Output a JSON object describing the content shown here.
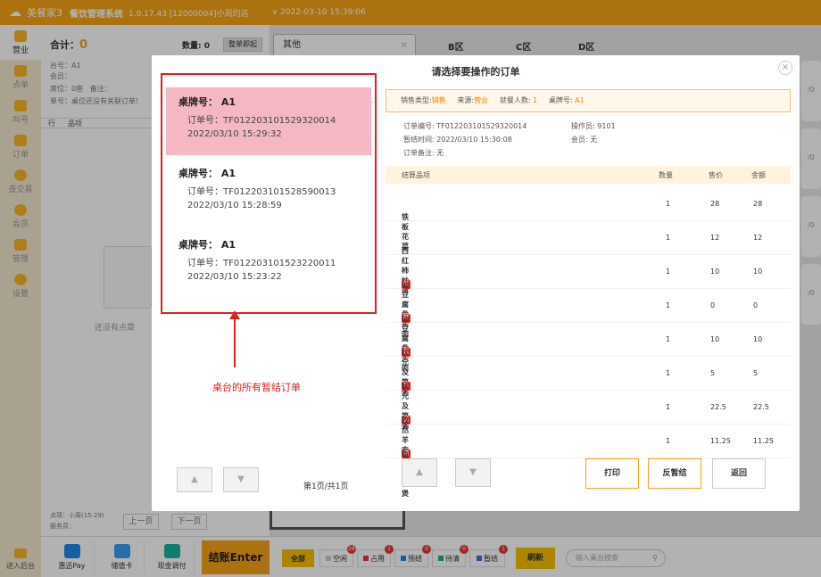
{
  "titlebar": {
    "brand": "美餐家3",
    "system": "餐饮管理系统",
    "version": "1.0.17.43 [12000004]小周的店",
    "datetime": "2022-03-10 15:39:06"
  },
  "nav": {
    "items": [
      {
        "label": "营业"
      },
      {
        "label": "点单"
      },
      {
        "label": "叫号"
      },
      {
        "label": "订单"
      },
      {
        "label": "查交易"
      },
      {
        "label": "会员"
      },
      {
        "label": "管理"
      },
      {
        "label": "设置"
      }
    ],
    "bottom": "进入后台"
  },
  "order": {
    "total_label": "合计：",
    "total_value": "0",
    "qty_label": "数量: 0",
    "qty_btn": "整单即起",
    "table": "台号：A1",
    "member": "会员：",
    "seats": "席位：0座",
    "remark": "备注：",
    "bill": "单号：桌位还没有关联订单!",
    "col_row": "行",
    "col_item": "品项",
    "empty": "还没有点菜",
    "footer_1": "点项：小周(15:29)",
    "footer_2": "服务员：",
    "prev": "上一页",
    "next": "下一页"
  },
  "tables": {
    "tab": "其他",
    "zones": [
      "B区",
      "C区",
      "D区"
    ],
    "side_marks": [
      "/0",
      "/0",
      "/0",
      "/0"
    ]
  },
  "bottombar": {
    "pay": [
      {
        "label": "惠迅Pay",
        "color": "#1a8cf0"
      },
      {
        "label": "储值卡",
        "color": "#3aa0f0"
      },
      {
        "label": "现金调付",
        "color": "#1bb3a0"
      }
    ],
    "checkout": "结账Enter",
    "filters": [
      {
        "label": "全部",
        "count": "",
        "color": "#f6c000"
      },
      {
        "label": "空闲",
        "count": "28",
        "color": "#cccccc"
      },
      {
        "label": "占用",
        "count": "1",
        "color": "#e23a3a"
      },
      {
        "label": "预结",
        "count": "0",
        "color": "#1a8cf0"
      },
      {
        "label": "待清",
        "count": "0",
        "color": "#2ab060"
      },
      {
        "label": "暂结",
        "count": "1",
        "color": "#3a70e0"
      }
    ],
    "refresh": "刷新",
    "search_placeholder": "输入桌台搜索"
  },
  "modal": {
    "title": "请选择要操作的订单",
    "orders": [
      {
        "table": "桌牌号： A1",
        "order_no": "订单号：TF012203101529320014",
        "time": "2022/03/10 15:29:32",
        "selected": true
      },
      {
        "table": "桌牌号： A1",
        "order_no": "订单号：TF012203101528590013",
        "time": "2022/03/10 15:28:59",
        "selected": false
      },
      {
        "table": "桌牌号： A1",
        "order_no": "订单号：TF012203101523220011",
        "time": "2022/03/10 15:23:22",
        "selected": false
      }
    ],
    "annotation": "桌台的所有暂结订单",
    "page_info": "第1页/共1页",
    "infobar": {
      "sale_type_label": "销售类型:",
      "sale_type": "销售",
      "source_label": "来源:",
      "source": "营业",
      "diners_label": "就餐人数:",
      "diners": "1",
      "table_label": "桌牌号:",
      "table": "A1"
    },
    "detail": {
      "order_no": "订单编号:  TF012203101529320014",
      "operator": "操作员: 9101",
      "hold_time": "暂结时间:  2022/03/10 15:30:08",
      "member": "会员: 无",
      "remark": "订单备注:  无"
    },
    "goods_header": {
      "name": "结算品项",
      "qty": "数量",
      "price": "售价",
      "amount": "金额"
    },
    "goods": [
      {
        "tag": "",
        "name": "铁板花菜",
        "qty": "1",
        "price": "28",
        "amount": "28"
      },
      {
        "tag": "",
        "name": "西红柿炒蛋",
        "qty": "1",
        "price": "12",
        "amount": "12"
      },
      {
        "tag": "促",
        "name": "油豆腐骨头肉",
        "qty": "1",
        "price": "10",
        "amount": "10"
      },
      {
        "tag": "赠",
        "name": "油豆腐骨头肉",
        "qty": "1",
        "price": "0",
        "amount": "0"
      },
      {
        "tag": "促",
        "name": "状元及第粥",
        "qty": "1",
        "price": "10",
        "amount": "10"
      },
      {
        "tag": "半",
        "name": "状元及第粥",
        "qty": "1",
        "price": "5",
        "amount": "5"
      },
      {
        "tag": "促",
        "name": "孜然羊肉",
        "qty": "1",
        "price": "22.5",
        "amount": "22.5"
      },
      {
        "tag": "促",
        "name": "鱼香茄子煲",
        "qty": "1",
        "price": "11.25",
        "amount": "11.25"
      }
    ],
    "buttons": {
      "print": "打印",
      "unhold": "反暂结",
      "back": "返回"
    }
  }
}
